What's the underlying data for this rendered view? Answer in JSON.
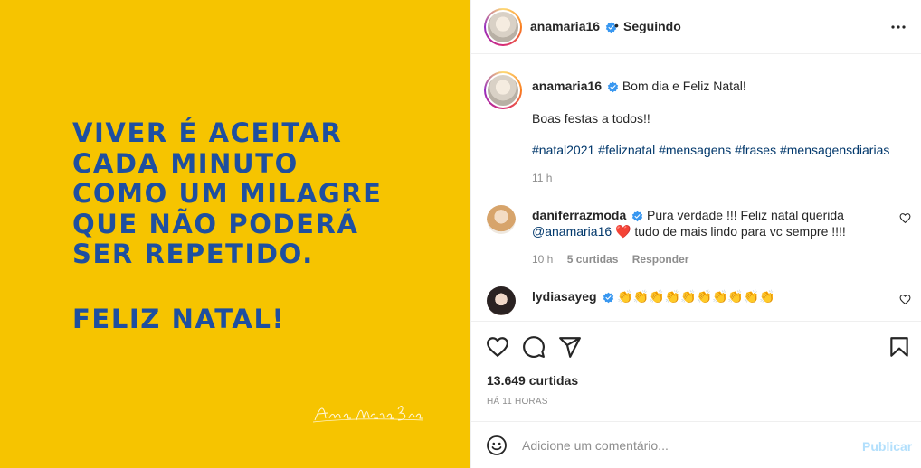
{
  "post_image": {
    "quote_lines": [
      "VIVER É ACEITAR",
      "CADA MINUTO",
      "COMO UM MILAGRE",
      "QUE NÃO PODERÁ",
      "SER REPETIDO."
    ],
    "greeting": "FELIZ NATAL!",
    "signature_text": "Ana Maria Braga",
    "background_color": "#f6c400",
    "text_color": "#1e4fa0"
  },
  "header": {
    "username": "anamaria16",
    "separator": "•",
    "follow_status": "Seguindo"
  },
  "caption": {
    "username": "anamaria16",
    "text": "Bom dia e Feliz Natal!",
    "line2": "Boas festas a todos!!",
    "hashtags": "#natal2021 #feliznatal #mensagens #frases #mensagensdiarias",
    "time": "11 h"
  },
  "comments": [
    {
      "username": "daniferrazmoda",
      "text_before": "Pura verdade !!! Feliz natal querida",
      "mention": "@anamaria16",
      "heart": "❤️",
      "text_after": "tudo de mais lindo para vc sempre !!!!",
      "time": "10 h",
      "likes": "5 curtidas",
      "reply": "Responder"
    },
    {
      "username": "lydiasayeg",
      "text": "👏👏👏👏👏👏👏👏👏👏"
    }
  ],
  "actions": {
    "likes": "13.649 curtidas",
    "time_ago": "HÁ 11 HORAS"
  },
  "add_comment": {
    "placeholder": "Adicione um comentário...",
    "publish": "Publicar"
  },
  "colors": {
    "verified": "#3897f0",
    "link": "#00376b",
    "muted": "#8e8e8e",
    "publish_disabled": "#b2dffc"
  }
}
